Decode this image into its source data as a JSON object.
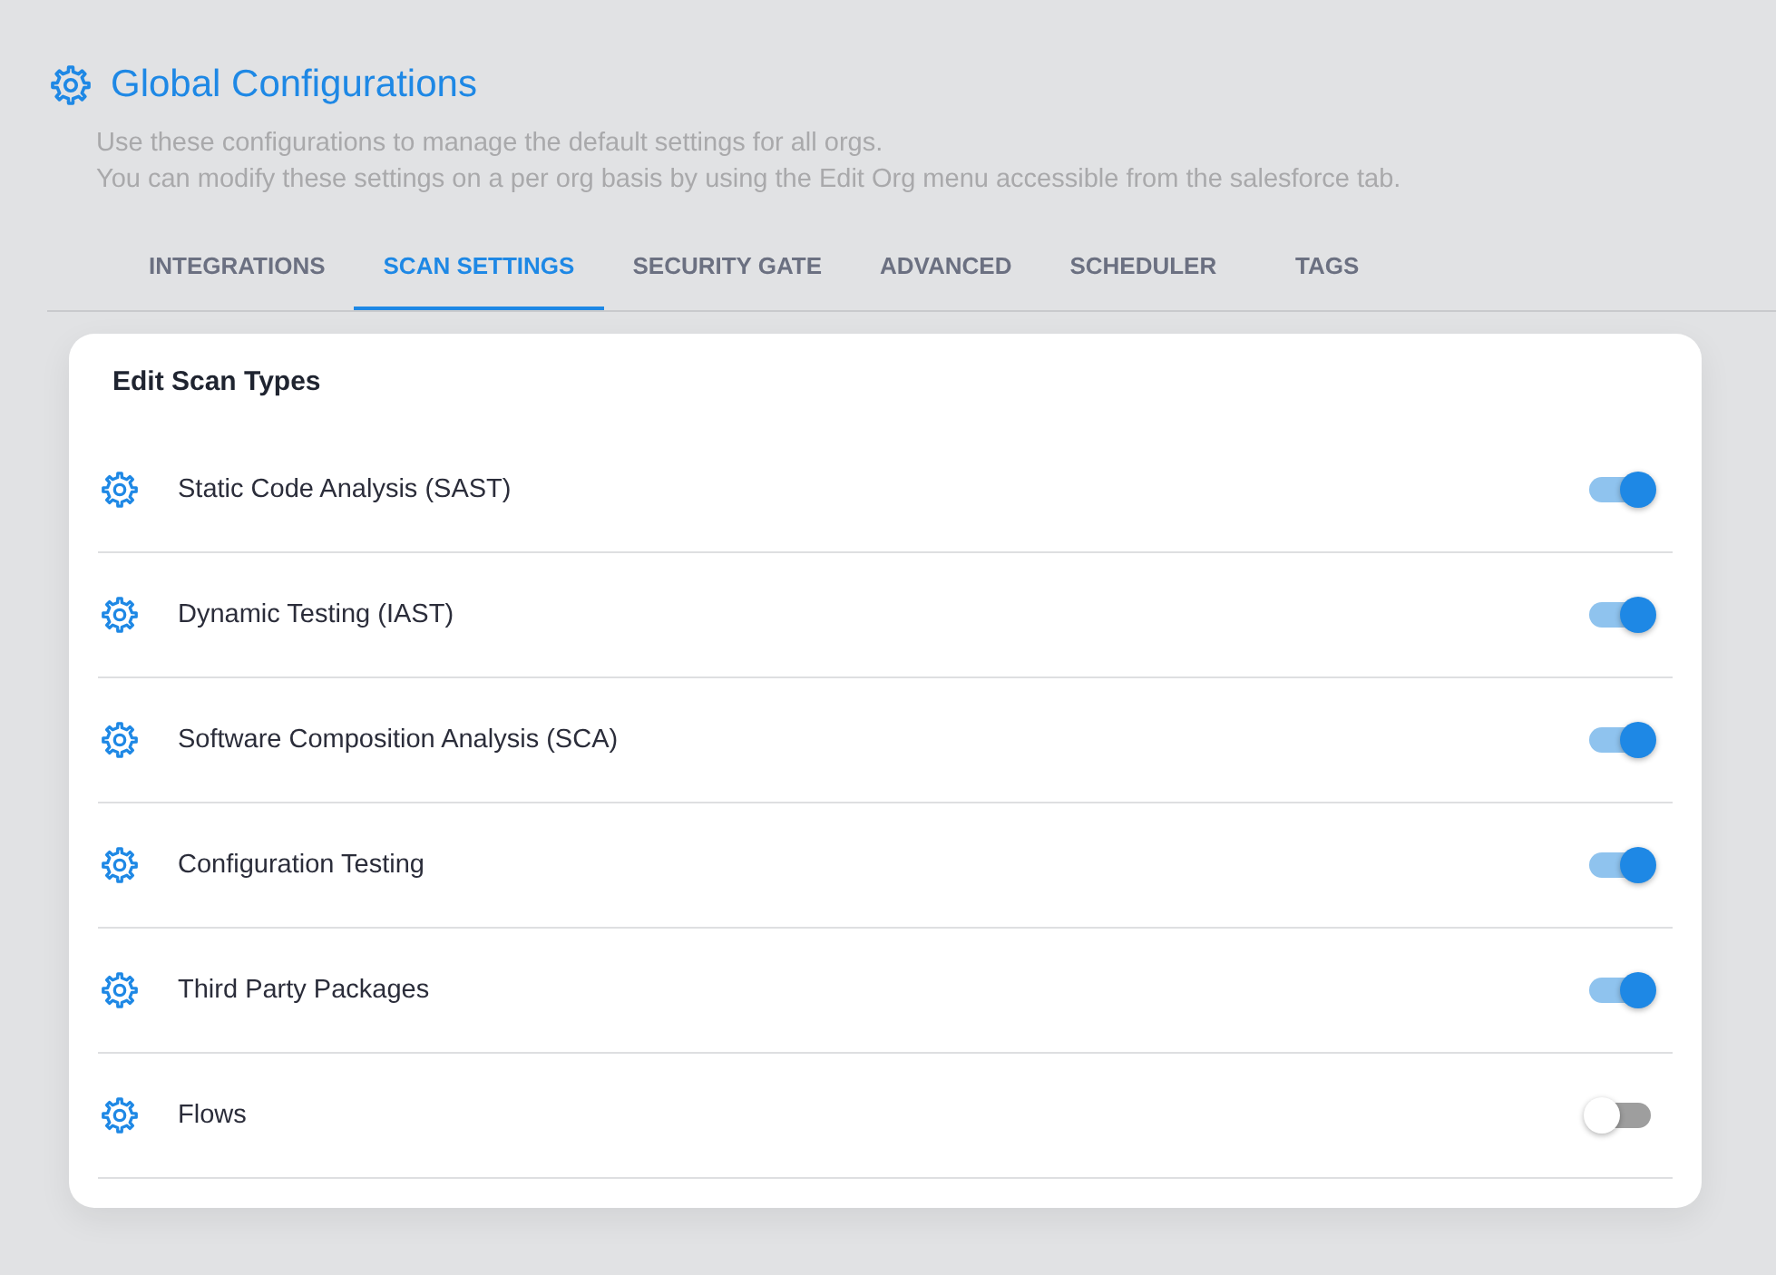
{
  "header": {
    "title": "Global Configurations",
    "description": [
      "Use these configurations to manage the default settings for all orgs.",
      "You can modify these settings on a per org basis by using the Edit Org menu accessible from the salesforce tab."
    ]
  },
  "tabs": [
    {
      "label": "INTEGRATIONS",
      "selected": false
    },
    {
      "label": "SCAN SETTINGS",
      "selected": true
    },
    {
      "label": "SECURITY GATE",
      "selected": false
    },
    {
      "label": "ADVANCED",
      "selected": false
    },
    {
      "label": "SCHEDULER",
      "selected": false
    },
    {
      "label": "TAGS",
      "selected": false
    }
  ],
  "card": {
    "title": "Edit Scan Types",
    "items": [
      {
        "label": "Static Code Analysis (SAST)",
        "on": true
      },
      {
        "label": "Dynamic Testing (IAST)",
        "on": true
      },
      {
        "label": "Software Composition Analysis (SCA)",
        "on": true
      },
      {
        "label": "Configuration Testing",
        "on": true
      },
      {
        "label": "Third Party Packages",
        "on": true
      },
      {
        "label": "Flows",
        "on": false
      }
    ]
  }
}
